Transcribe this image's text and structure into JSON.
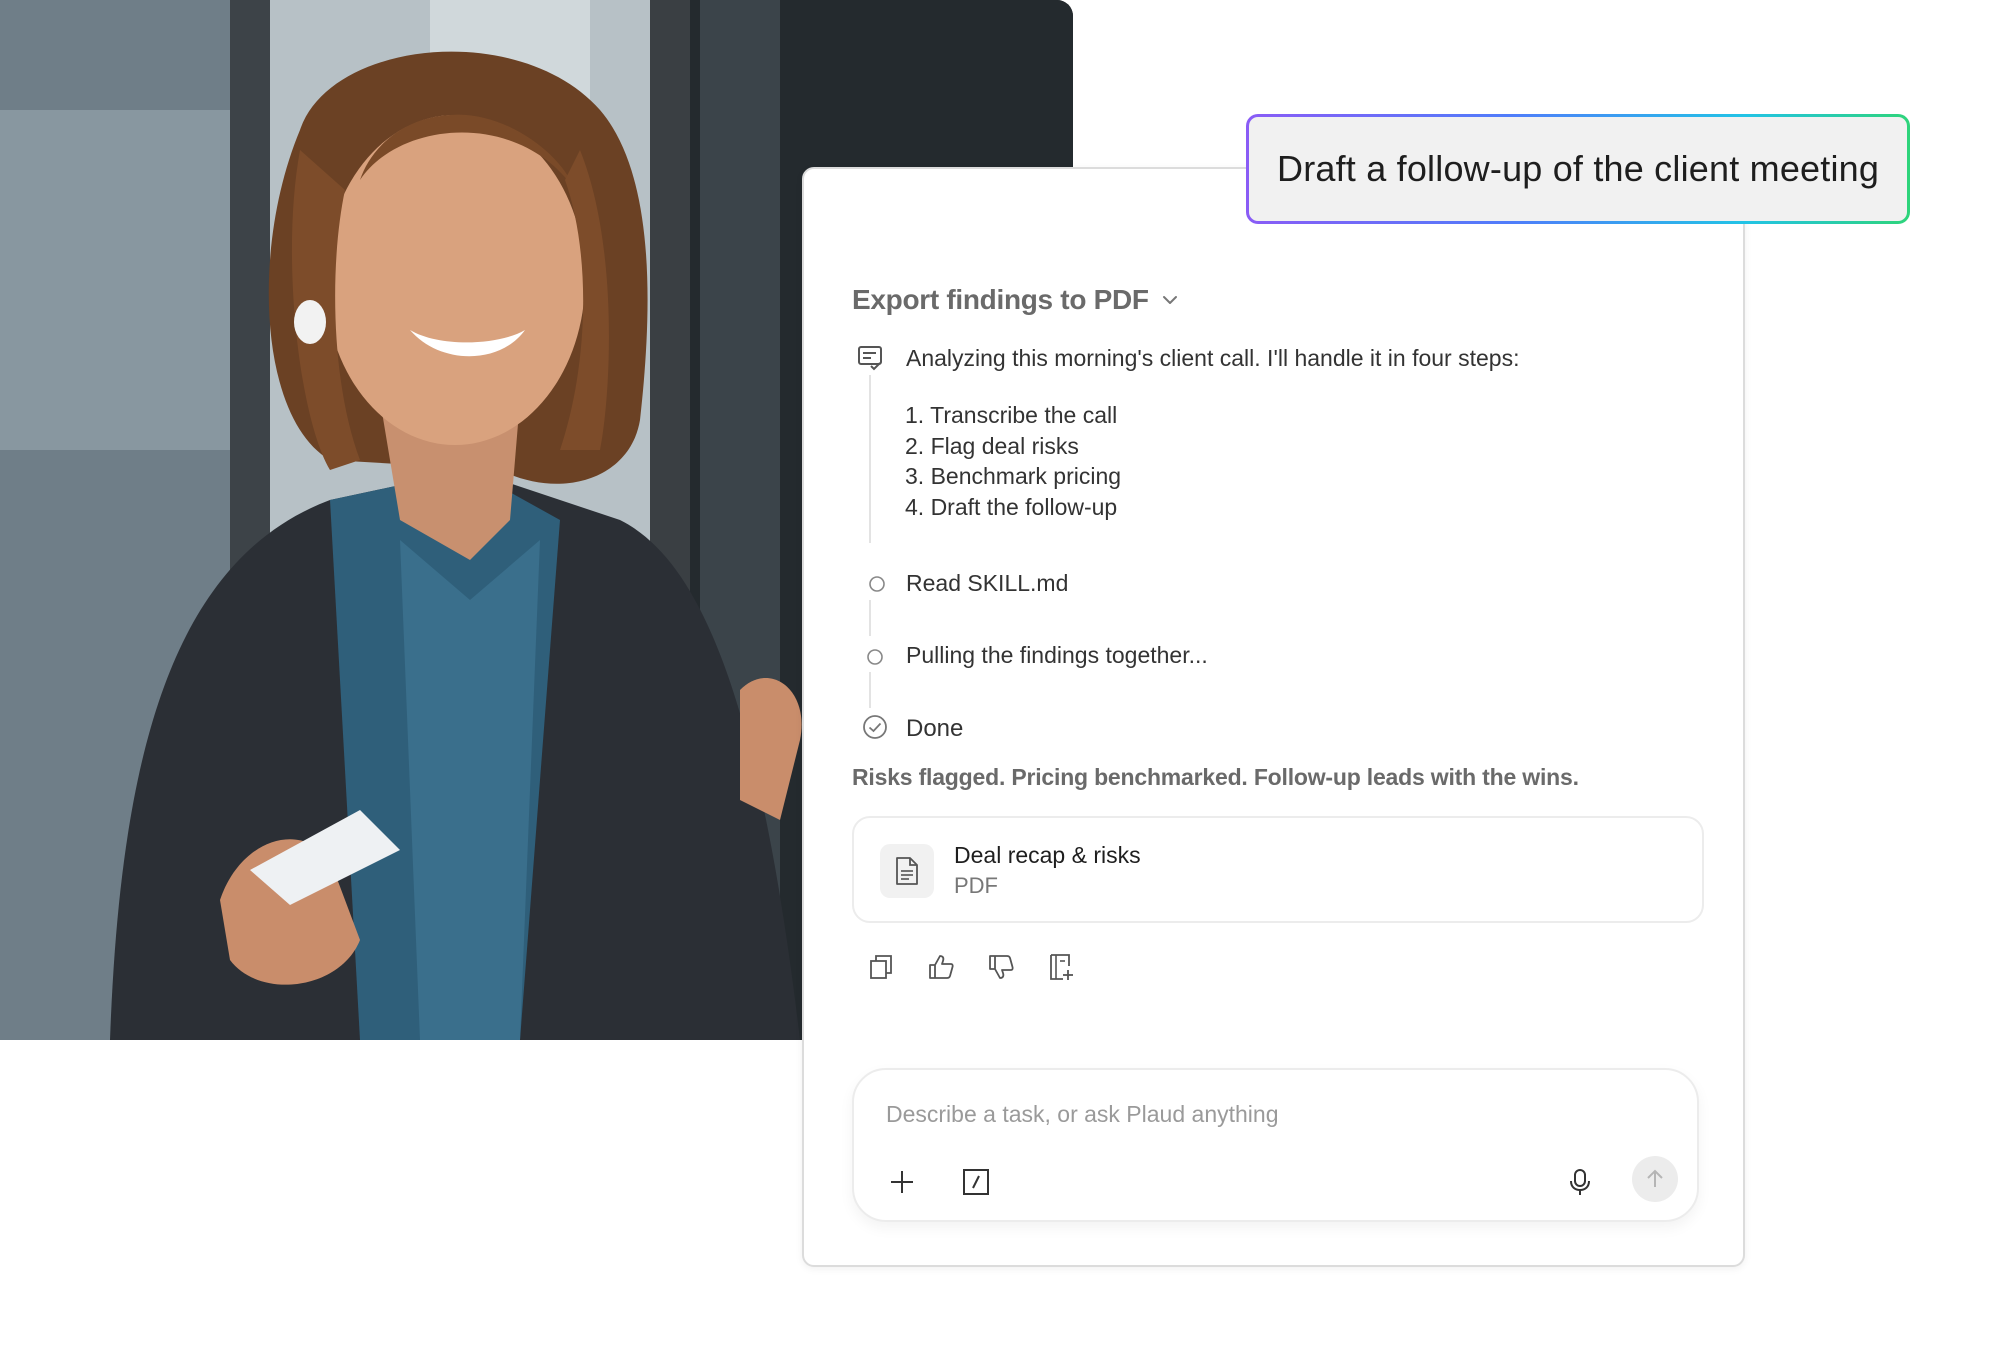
{
  "prompt": {
    "text": "Draft a follow-up of the client meeting"
  },
  "task": {
    "title": "Export findings to PDF",
    "intro": "Analyzing this morning's client call. I'll handle it in four steps:",
    "plan": [
      "1. Transcribe the call",
      "2. Flag deal risks",
      "3. Benchmark pricing",
      "4. Draft the follow-up"
    ],
    "steps": [
      {
        "label": "Read SKILL.md",
        "status": "pending"
      },
      {
        "label": "Pulling the findings together...",
        "status": "pending"
      },
      {
        "label": "Done",
        "status": "complete"
      }
    ],
    "summary": "Risks flagged. Pricing benchmarked. Follow-up leads with the wins."
  },
  "attachment": {
    "name": "Deal recap & risks",
    "type": "PDF"
  },
  "actions": [
    "copy-icon",
    "thumbs-up-icon",
    "thumbs-down-icon",
    "save-to-notes-icon"
  ],
  "input": {
    "placeholder": "Describe a task, or ask Plaud anything",
    "value": ""
  },
  "colors": {
    "gradient": [
      "#8a5cf6",
      "#4f7dfa",
      "#22c3e6",
      "#2ed47a"
    ],
    "muted_text": "#6a6a6a"
  }
}
